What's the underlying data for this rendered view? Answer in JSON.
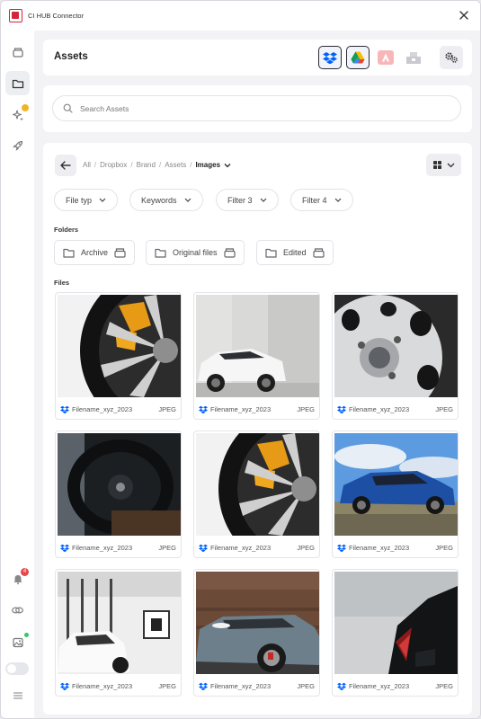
{
  "window": {
    "title": "CI HUB Connector"
  },
  "header": {
    "title": "Assets",
    "settings_icon": "settings-gear-icon"
  },
  "sources": [
    {
      "name": "dropbox",
      "icon": "dropbox-icon",
      "selected": true
    },
    {
      "name": "google-drive",
      "icon": "google-drive-icon",
      "selected": true
    },
    {
      "name": "adobe",
      "icon": "adobe-icon",
      "selected": false
    },
    {
      "name": "archive",
      "icon": "box-icon",
      "selected": false
    }
  ],
  "search": {
    "placeholder": "Search Assets",
    "value": ""
  },
  "breadcrumb": {
    "items": [
      "All",
      "Dropbox",
      "Brand",
      "Assets"
    ],
    "current": "Images"
  },
  "filters": [
    "File typ",
    "Keywords",
    "Filter 3",
    "Filter 4"
  ],
  "folders": {
    "label": "Folders",
    "items": [
      "Archive",
      "Original files",
      "Edited"
    ]
  },
  "files": {
    "label": "Files",
    "items": [
      {
        "name": "Filename_xyz_2023",
        "type": "JPEG",
        "scene": "brake-caliper-wheel"
      },
      {
        "name": "Filename_xyz_2023",
        "type": "JPEG",
        "scene": "white-suv-concrete-wall"
      },
      {
        "name": "Filename_xyz_2023",
        "type": "JPEG",
        "scene": "alloy-wheel-hub"
      },
      {
        "name": "Filename_xyz_2023",
        "type": "JPEG",
        "scene": "steering-wheel-interior"
      },
      {
        "name": "Filename_xyz_2023",
        "type": "JPEG",
        "scene": "brake-caliper-wheel"
      },
      {
        "name": "Filename_xyz_2023",
        "type": "JPEG",
        "scene": "blue-suv-field"
      },
      {
        "name": "Filename_xyz_2023",
        "type": "JPEG",
        "scene": "white-car-studio"
      },
      {
        "name": "Filename_xyz_2023",
        "type": "JPEG",
        "scene": "grey-car-brick-wall"
      },
      {
        "name": "Filename_xyz_2023",
        "type": "JPEG",
        "scene": "dark-car-taillight"
      }
    ]
  },
  "sidebar": {
    "items": [
      "box-icon",
      "folder-icon",
      "sparkle-icon",
      "rocket-icon"
    ],
    "bottom": [
      "bell-icon",
      "link-icon",
      "image-icon",
      "toggle",
      "menu-icon"
    ],
    "notification_count": "4"
  },
  "colors": {
    "accent": "#d6243a",
    "dropbox": "#0061fe",
    "badge": "#e5484d",
    "sparkle_badge": "#f0b429",
    "online": "#3cc46b"
  }
}
